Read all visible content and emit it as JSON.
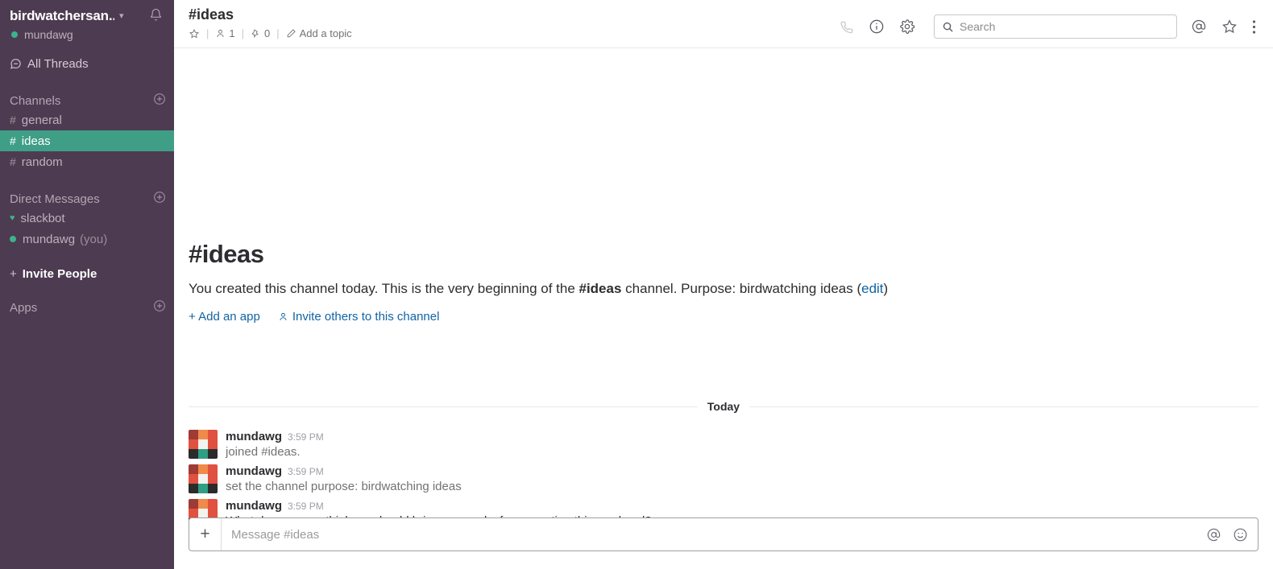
{
  "sidebar": {
    "workspace_name": "birdwatchersan...",
    "workspace_chevron_icon": "chevron-down-icon",
    "notifications_icon": "bell-icon",
    "current_user": "mundawg",
    "all_threads_label": "All Threads",
    "all_threads_icon": "threads-icon",
    "sections": [
      {
        "title": "Channels",
        "add_icon": "plus-circle-icon",
        "items": [
          {
            "prefix": "#",
            "label": "general",
            "active": false
          },
          {
            "prefix": "#",
            "label": "ideas",
            "active": true
          },
          {
            "prefix": "#",
            "label": "random",
            "active": false
          }
        ]
      },
      {
        "title": "Direct Messages",
        "add_icon": "plus-circle-icon",
        "items": [
          {
            "prefix": "heart",
            "label": "slackbot",
            "suffix": "",
            "active": false
          },
          {
            "prefix": "dot",
            "label": "mundawg",
            "suffix": "(you)",
            "active": false
          }
        ]
      }
    ],
    "invite_people_label": "Invite People",
    "apps_title": "Apps",
    "apps_add_icon": "plus-circle-icon",
    "active_color": "#3f9e86",
    "background_color": "#4d3b51",
    "presence_color": "#3db38b"
  },
  "topbar": {
    "channel_title": "#ideas",
    "star_icon": "star-outline-icon",
    "members_icon": "person-icon",
    "members_count": "1",
    "pins_icon": "pin-icon",
    "pins_count": "0",
    "topic_icon": "pencil-icon",
    "topic_label": "Add a topic",
    "call_icon": "phone-icon",
    "info_icon": "info-circle-icon",
    "settings_icon": "gear-icon",
    "search": {
      "icon": "search-icon",
      "placeholder": "Search",
      "value": ""
    },
    "mentions_icon": "at-icon",
    "starred_icon": "star-outline-icon",
    "more_icon": "kebab-menu-icon"
  },
  "intro": {
    "heading_hash": "#",
    "heading_name": "ideas",
    "body_part1": "You created this channel today. This is the very beginning of the ",
    "body_channel": "#ideas",
    "body_part2": " channel. Purpose: birdwatching ideas (",
    "body_edit_link": "edit",
    "body_part3": ")",
    "add_app_label": "+ Add an app",
    "invite_others_label": "Invite others to this channel",
    "invite_others_icon": "person-icon"
  },
  "messages": {
    "divider_label": "Today",
    "items": [
      {
        "avatar": "identicon",
        "user": "mundawg",
        "time": "3:59 PM",
        "text": "joined #ideas.",
        "system": true
      },
      {
        "avatar": "identicon",
        "user": "mundawg",
        "time": "3:59 PM",
        "text": "set the channel purpose: birdwatching ideas",
        "system": true
      },
      {
        "avatar": "identicon",
        "user": "mundawg",
        "time": "3:59 PM",
        "text": "What do you guys think we should bring as snacks for our outing this weekend?",
        "system": false
      }
    ]
  },
  "composer": {
    "attach_icon": "plus-icon",
    "attach_label": "+",
    "placeholder": "Message #ideas",
    "value": "",
    "mention_icon": "at-icon",
    "emoji_icon": "smiley-icon"
  }
}
